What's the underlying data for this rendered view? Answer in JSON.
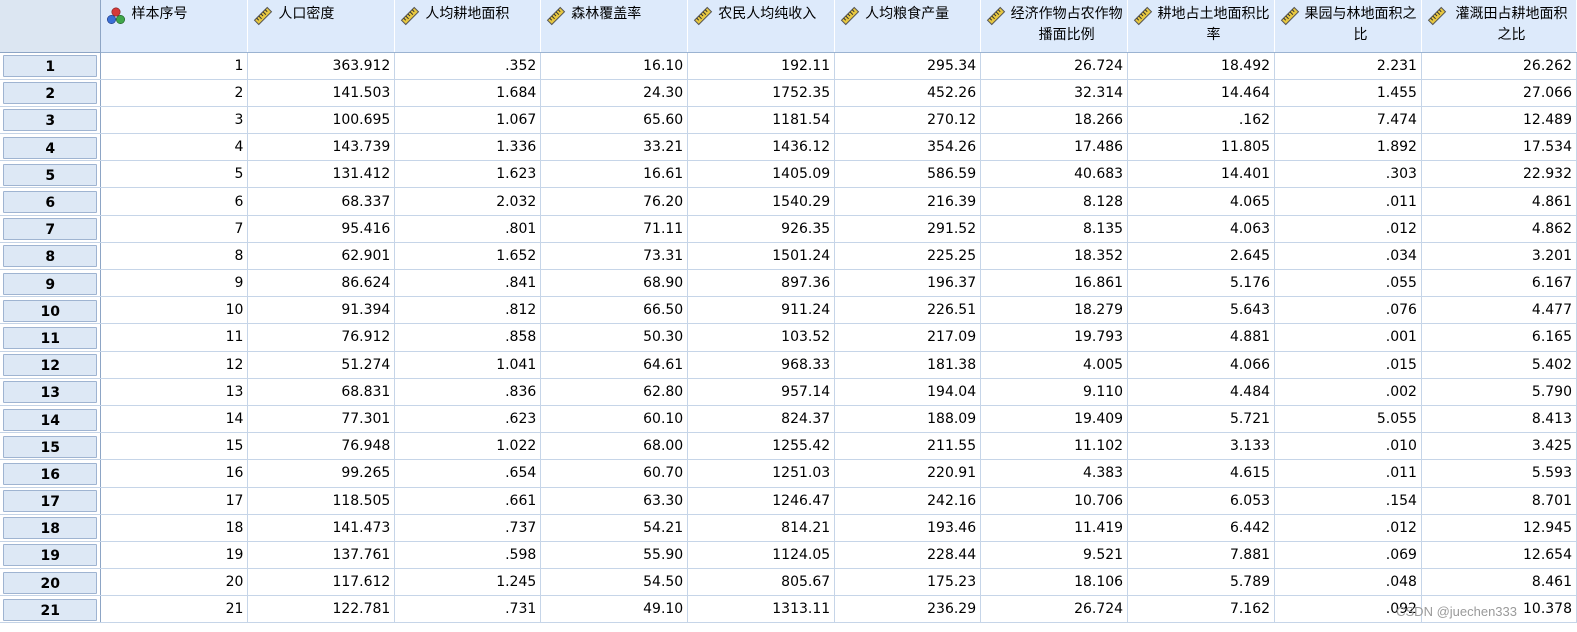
{
  "columns": [
    {
      "label": "样本序号",
      "icon": "nominal-measure-icon"
    },
    {
      "label": "人口密度",
      "icon": "scale-measure-icon"
    },
    {
      "label": "人均耕地面积",
      "icon": "scale-measure-icon"
    },
    {
      "label": "森林覆盖率",
      "icon": "scale-measure-icon"
    },
    {
      "label": "农民人均纯收入",
      "icon": "scale-measure-icon"
    },
    {
      "label": "人均粮食产量",
      "icon": "scale-measure-icon"
    },
    {
      "label": "经济作物占农作物播面比例",
      "icon": "scale-measure-icon"
    },
    {
      "label": "耕地占土地面积比率",
      "icon": "scale-measure-icon"
    },
    {
      "label": "果园与林地面积之比",
      "icon": "scale-measure-icon"
    },
    {
      "label": "灌溉田占耕地面积之比",
      "icon": "scale-measure-icon"
    }
  ],
  "rows": [
    {
      "n": "1",
      "cells": [
        "1",
        "363.912",
        ".352",
        "16.10",
        "192.11",
        "295.34",
        "26.724",
        "18.492",
        "2.231",
        "26.262"
      ]
    },
    {
      "n": "2",
      "cells": [
        "2",
        "141.503",
        "1.684",
        "24.30",
        "1752.35",
        "452.26",
        "32.314",
        "14.464",
        "1.455",
        "27.066"
      ]
    },
    {
      "n": "3",
      "cells": [
        "3",
        "100.695",
        "1.067",
        "65.60",
        "1181.54",
        "270.12",
        "18.266",
        ".162",
        "7.474",
        "12.489"
      ]
    },
    {
      "n": "4",
      "cells": [
        "4",
        "143.739",
        "1.336",
        "33.21",
        "1436.12",
        "354.26",
        "17.486",
        "11.805",
        "1.892",
        "17.534"
      ]
    },
    {
      "n": "5",
      "cells": [
        "5",
        "131.412",
        "1.623",
        "16.61",
        "1405.09",
        "586.59",
        "40.683",
        "14.401",
        ".303",
        "22.932"
      ]
    },
    {
      "n": "6",
      "cells": [
        "6",
        "68.337",
        "2.032",
        "76.20",
        "1540.29",
        "216.39",
        "8.128",
        "4.065",
        ".011",
        "4.861"
      ]
    },
    {
      "n": "7",
      "cells": [
        "7",
        "95.416",
        ".801",
        "71.11",
        "926.35",
        "291.52",
        "8.135",
        "4.063",
        ".012",
        "4.862"
      ]
    },
    {
      "n": "8",
      "cells": [
        "8",
        "62.901",
        "1.652",
        "73.31",
        "1501.24",
        "225.25",
        "18.352",
        "2.645",
        ".034",
        "3.201"
      ]
    },
    {
      "n": "9",
      "cells": [
        "9",
        "86.624",
        ".841",
        "68.90",
        "897.36",
        "196.37",
        "16.861",
        "5.176",
        ".055",
        "6.167"
      ]
    },
    {
      "n": "10",
      "cells": [
        "10",
        "91.394",
        ".812",
        "66.50",
        "911.24",
        "226.51",
        "18.279",
        "5.643",
        ".076",
        "4.477"
      ]
    },
    {
      "n": "11",
      "cells": [
        "11",
        "76.912",
        ".858",
        "50.30",
        "103.52",
        "217.09",
        "19.793",
        "4.881",
        ".001",
        "6.165"
      ]
    },
    {
      "n": "12",
      "cells": [
        "12",
        "51.274",
        "1.041",
        "64.61",
        "968.33",
        "181.38",
        "4.005",
        "4.066",
        ".015",
        "5.402"
      ]
    },
    {
      "n": "13",
      "cells": [
        "13",
        "68.831",
        ".836",
        "62.80",
        "957.14",
        "194.04",
        "9.110",
        "4.484",
        ".002",
        "5.790"
      ]
    },
    {
      "n": "14",
      "cells": [
        "14",
        "77.301",
        ".623",
        "60.10",
        "824.37",
        "188.09",
        "19.409",
        "5.721",
        "5.055",
        "8.413"
      ]
    },
    {
      "n": "15",
      "cells": [
        "15",
        "76.948",
        "1.022",
        "68.00",
        "1255.42",
        "211.55",
        "11.102",
        "3.133",
        ".010",
        "3.425"
      ]
    },
    {
      "n": "16",
      "cells": [
        "16",
        "99.265",
        ".654",
        "60.70",
        "1251.03",
        "220.91",
        "4.383",
        "4.615",
        ".011",
        "5.593"
      ]
    },
    {
      "n": "17",
      "cells": [
        "17",
        "118.505",
        ".661",
        "63.30",
        "1246.47",
        "242.16",
        "10.706",
        "6.053",
        ".154",
        "8.701"
      ]
    },
    {
      "n": "18",
      "cells": [
        "18",
        "141.473",
        ".737",
        "54.21",
        "814.21",
        "193.46",
        "11.419",
        "6.442",
        ".012",
        "12.945"
      ]
    },
    {
      "n": "19",
      "cells": [
        "19",
        "137.761",
        ".598",
        "55.90",
        "1124.05",
        "228.44",
        "9.521",
        "7.881",
        ".069",
        "12.654"
      ]
    },
    {
      "n": "20",
      "cells": [
        "20",
        "117.612",
        "1.245",
        "54.50",
        "805.67",
        "175.23",
        "18.106",
        "5.789",
        ".048",
        "8.461"
      ]
    },
    {
      "n": "21",
      "cells": [
        "21",
        "122.781",
        ".731",
        "49.10",
        "1313.11",
        "236.29",
        "26.724",
        "7.162",
        ".092",
        "10.378"
      ]
    }
  ],
  "watermark": "CSDN @juechen333",
  "colors": {
    "header_bg": "#ddeafb",
    "row_button_bg": "#dde8f5",
    "grid_line": "#c6d5e8",
    "scale_icon_fill": "#e8c840",
    "nominal_red": "#d63a3a",
    "nominal_blue": "#3a6fd6",
    "nominal_green": "#3fa64a"
  }
}
